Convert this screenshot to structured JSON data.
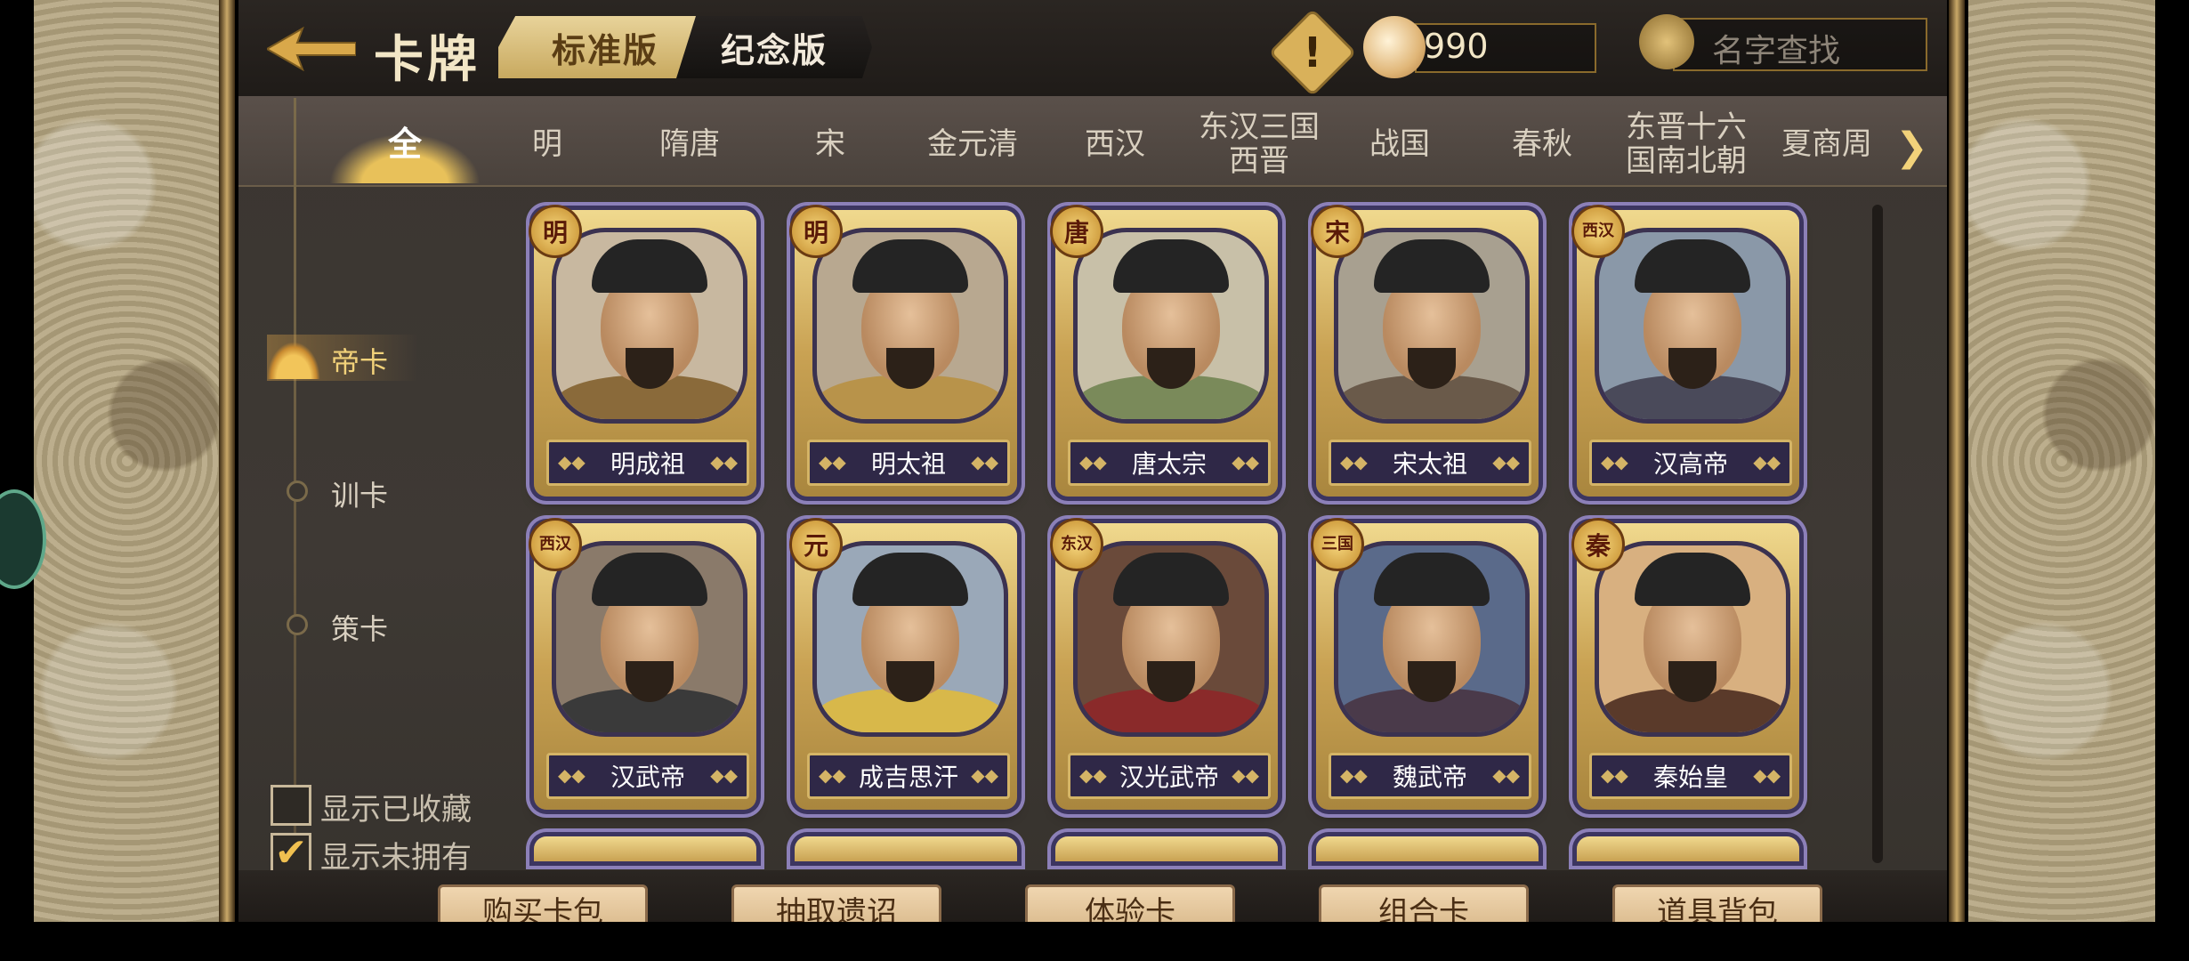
{
  "header": {
    "title": "卡牌",
    "version_tabs": [
      "标准版",
      "纪念版"
    ],
    "currency_value": "990",
    "search_placeholder": "名字查找"
  },
  "dynasty_tabs": [
    "全",
    "明",
    "隋唐",
    "宋",
    "金元清",
    "西汉",
    "东汉三国\n西晋",
    "战国",
    "春秋",
    "东晋十六\n国南北朝",
    "夏商周"
  ],
  "categories": [
    "帝卡",
    "训卡",
    "策卡"
  ],
  "filters": {
    "show_favorited": "显示已收藏",
    "show_favorited_checked": false,
    "show_unowned": "显示未拥有",
    "show_unowned_checked": true
  },
  "cards": [
    {
      "badge": "明",
      "name": "明成祖"
    },
    {
      "badge": "明",
      "name": "明太祖"
    },
    {
      "badge": "唐",
      "name": "唐太宗"
    },
    {
      "badge": "宋",
      "name": "宋太祖"
    },
    {
      "badge": "西汉",
      "name": "汉高帝"
    },
    {
      "badge": "西汉",
      "name": "汉武帝"
    },
    {
      "badge": "元",
      "name": "成吉思汗"
    },
    {
      "badge": "东汉",
      "name": "汉光武帝"
    },
    {
      "badge": "三国",
      "name": "魏武帝"
    },
    {
      "badge": "秦",
      "name": "秦始皇"
    }
  ],
  "bottom_buttons": [
    "购买卡包",
    "抽取遗诏",
    "体验卡",
    "组合卡",
    "道具背包"
  ],
  "colors": {
    "gold": "#d4b466",
    "card_frame": "#8c80b8",
    "nameplate": "#2f2847"
  }
}
